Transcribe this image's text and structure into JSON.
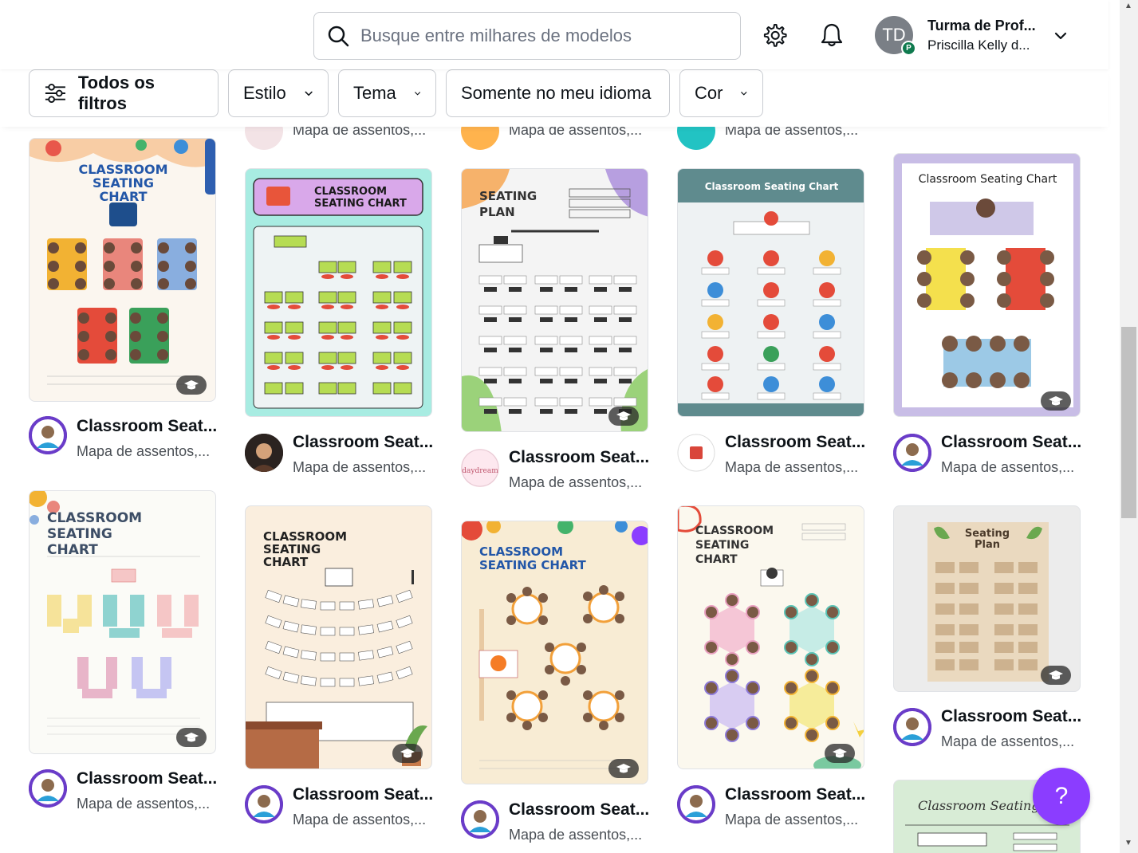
{
  "header": {
    "search_placeholder": "Busque entre milhares de modelos",
    "account_initials": "TD",
    "account_badge": "P",
    "account_name": "Turma de Prof...",
    "account_user": "Priscilla Kelly d..."
  },
  "filters": {
    "all_filters": "Todos os filtros",
    "style": "Estilo",
    "theme": "Tema",
    "language": "Somente no meu idioma",
    "color": "Cor"
  },
  "partial_row": {
    "sub1": "Mapa de assentos,...",
    "sub2": "Mapa de assentos,...",
    "sub3": "Mapa de assentos,..."
  },
  "cards": [
    {
      "title": "Classroom Seat...",
      "subtitle": "Mapa de assentos,...",
      "heading": "CLASSROOM SEATING CHART"
    },
    {
      "title": "Classroom Seat...",
      "subtitle": "Mapa de assentos,...",
      "heading": "CLASSROOM SEATING CHART"
    },
    {
      "title": "Classroom Seat...",
      "subtitle": "Mapa de assentos,...",
      "heading": "SEATING PLAN"
    },
    {
      "title": "Classroom Seat...",
      "subtitle": "Mapa de assentos,...",
      "heading": "Classroom Seating Chart"
    },
    {
      "title": "Classroom Seat...",
      "subtitle": "Mapa de assentos,...",
      "heading": "Classroom Seating Chart"
    },
    {
      "title": "Classroom Seat...",
      "subtitle": "Mapa de assentos,...",
      "heading": "CLASSROOM SEATING CHART"
    },
    {
      "title": "Classroom Seat...",
      "subtitle": "Mapa de assentos,...",
      "heading": "CLASSROOM SEATING CHART"
    },
    {
      "title": "Classroom Seat...",
      "subtitle": "Mapa de assentos,...",
      "heading": "CLASSROOM SEATING CHART"
    },
    {
      "title": "Classroom Seat...",
      "subtitle": "Mapa de assentos,...",
      "heading": "CLASSROOM SEATING CHART"
    },
    {
      "title": "Classroom Seat...",
      "subtitle": "Mapa de assentos,...",
      "heading": "Seating Plan"
    },
    {
      "heading": "Classroom Seating Chart"
    }
  ],
  "help_label": "?"
}
